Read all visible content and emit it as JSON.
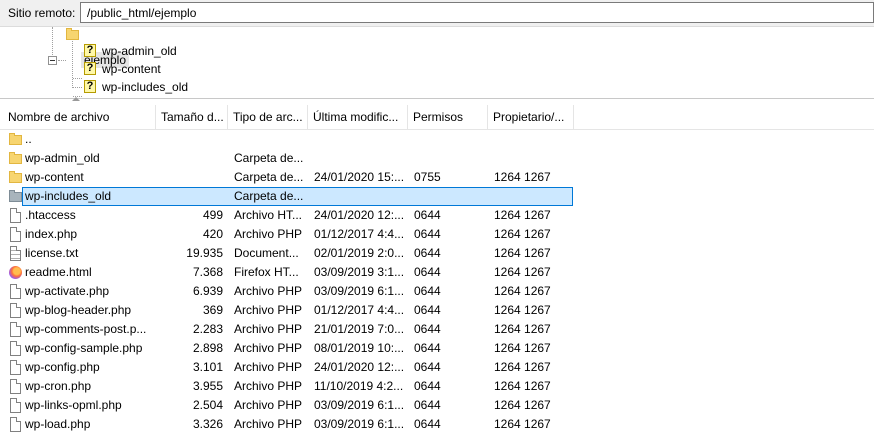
{
  "path_bar": {
    "label": "Sitio remoto:",
    "value": "/public_html/ejemplo"
  },
  "tree": {
    "selected": "ejemplo",
    "children": [
      "wp-admin_old",
      "wp-content",
      "wp-includes_old"
    ]
  },
  "columns": [
    "Nombre de archivo",
    "Tamaño d...",
    "Tipo de arc...",
    "Última modific...",
    "Permisos",
    "Propietario/..."
  ],
  "files": [
    {
      "name": "..",
      "size": "",
      "type": "",
      "modified": "",
      "perms": "",
      "owner": "",
      "icon": "folder-icon"
    },
    {
      "name": "wp-admin_old",
      "size": "",
      "type": "Carpeta de...",
      "modified": "",
      "perms": "",
      "owner": "",
      "icon": "folder-icon"
    },
    {
      "name": "wp-content",
      "size": "",
      "type": "Carpeta de...",
      "modified": "24/01/2020 15:...",
      "perms": "0755",
      "owner": "1264 1267",
      "icon": "folder-icon"
    },
    {
      "name": "wp-includes_old",
      "size": "",
      "type": "Carpeta de...",
      "modified": "",
      "perms": "",
      "owner": "",
      "icon": "folder-gray-icon",
      "selected": true
    },
    {
      "name": ".htaccess",
      "size": "499",
      "type": "Archivo HT...",
      "modified": "24/01/2020 12:...",
      "perms": "0644",
      "owner": "1264 1267",
      "icon": "file-icon"
    },
    {
      "name": "index.php",
      "size": "420",
      "type": "Archivo PHP",
      "modified": "01/12/2017 4:4...",
      "perms": "0644",
      "owner": "1264 1267",
      "icon": "file-icon"
    },
    {
      "name": "license.txt",
      "size": "19.935",
      "type": "Document...",
      "modified": "02/01/2019 2:0...",
      "perms": "0644",
      "owner": "1264 1267",
      "icon": "text-file-icon"
    },
    {
      "name": "readme.html",
      "size": "7.368",
      "type": "Firefox HT...",
      "modified": "03/09/2019 3:1...",
      "perms": "0644",
      "owner": "1264 1267",
      "icon": "firefox-icon"
    },
    {
      "name": "wp-activate.php",
      "size": "6.939",
      "type": "Archivo PHP",
      "modified": "03/09/2019 6:1...",
      "perms": "0644",
      "owner": "1264 1267",
      "icon": "file-icon"
    },
    {
      "name": "wp-blog-header.php",
      "size": "369",
      "type": "Archivo PHP",
      "modified": "01/12/2017 4:4...",
      "perms": "0644",
      "owner": "1264 1267",
      "icon": "file-icon"
    },
    {
      "name": "wp-comments-post.p...",
      "size": "2.283",
      "type": "Archivo PHP",
      "modified": "21/01/2019 7:0...",
      "perms": "0644",
      "owner": "1264 1267",
      "icon": "file-icon"
    },
    {
      "name": "wp-config-sample.php",
      "size": "2.898",
      "type": "Archivo PHP",
      "modified": "08/01/2019 10:...",
      "perms": "0644",
      "owner": "1264 1267",
      "icon": "file-icon"
    },
    {
      "name": "wp-config.php",
      "size": "3.101",
      "type": "Archivo PHP",
      "modified": "24/01/2020 12:...",
      "perms": "0644",
      "owner": "1264 1267",
      "icon": "file-icon"
    },
    {
      "name": "wp-cron.php",
      "size": "3.955",
      "type": "Archivo PHP",
      "modified": "11/10/2019 4:2...",
      "perms": "0644",
      "owner": "1264 1267",
      "icon": "file-icon"
    },
    {
      "name": "wp-links-opml.php",
      "size": "2.504",
      "type": "Archivo PHP",
      "modified": "03/09/2019 6:1...",
      "perms": "0644",
      "owner": "1264 1267",
      "icon": "file-icon"
    },
    {
      "name": "wp-load.php",
      "size": "3.326",
      "type": "Archivo PHP",
      "modified": "03/09/2019 6:1...",
      "perms": "0644",
      "owner": "1264 1267",
      "icon": "file-icon"
    }
  ]
}
